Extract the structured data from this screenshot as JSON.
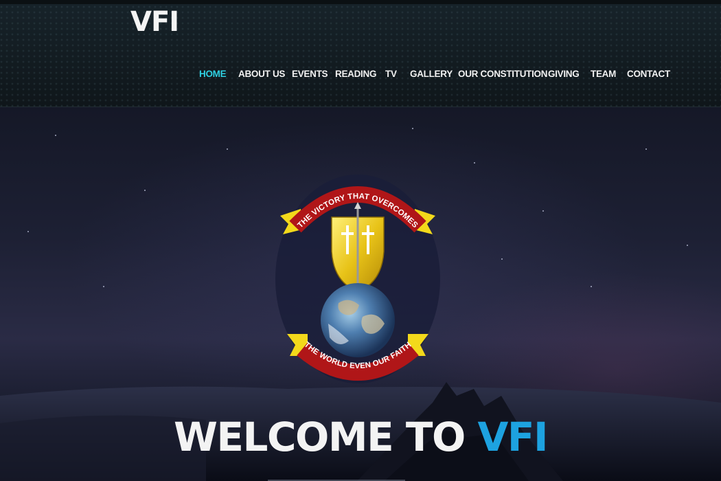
{
  "header": {
    "brand": "VFI",
    "nav": [
      {
        "label": "HOME",
        "active": true
      },
      {
        "label": "ABOUT US",
        "active": false
      },
      {
        "label": "EVENTS",
        "active": false
      },
      {
        "label": "READING",
        "active": false
      },
      {
        "label": "TV",
        "active": false
      },
      {
        "label": "GALLERY",
        "active": false
      },
      {
        "label": "OUR CONSTITUTION",
        "active": false
      },
      {
        "label": "GIVING",
        "active": false
      },
      {
        "label": "TEAM",
        "active": false
      },
      {
        "label": "CONTACT",
        "active": false
      }
    ],
    "active_color": "#2fd0e2"
  },
  "hero": {
    "emblem": {
      "top_banner": "THE VICTORY THAT OVERCOMES",
      "bottom_banner": "THE WORLD EVEN OUR FAITH",
      "icons": [
        "shield-icon",
        "cross-icon",
        "globe-icon"
      ]
    },
    "welcome": {
      "prefix": "WELCOME TO",
      "accent": "VFI",
      "accent_color": "#1da2e0"
    }
  }
}
